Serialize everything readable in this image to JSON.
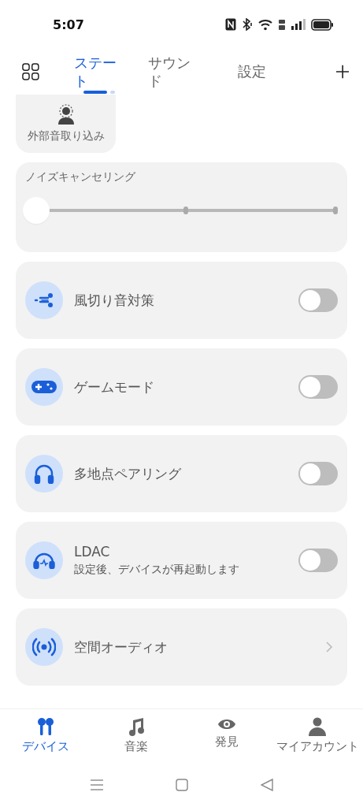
{
  "status_bar": {
    "time": "5:07"
  },
  "tabs": [
    {
      "label": "ステート",
      "selected": true
    },
    {
      "label": "サウンド",
      "selected": false
    },
    {
      "label": "設定",
      "selected": false
    }
  ],
  "ambient_card": {
    "label": "外部音取り込み"
  },
  "noise_cancelling": {
    "title": "ノイズキャンセリング",
    "level": 0
  },
  "settings": [
    {
      "kind": "toggle",
      "label": "風切り音対策",
      "on": false
    },
    {
      "kind": "toggle",
      "label": "ゲームモード",
      "on": false
    },
    {
      "kind": "toggle",
      "label": "多地点ペアリング",
      "on": false
    },
    {
      "kind": "toggle",
      "label": "LDAC",
      "note": "設定後、デバイスが再起動します",
      "on": false
    },
    {
      "kind": "link",
      "label": "空間オーディオ"
    }
  ],
  "bottom_nav": [
    {
      "label": "デバイス",
      "selected": true
    },
    {
      "label": "音楽",
      "selected": false
    },
    {
      "label": "発見",
      "selected": false
    },
    {
      "label": "マイアカウント",
      "selected": false
    }
  ]
}
